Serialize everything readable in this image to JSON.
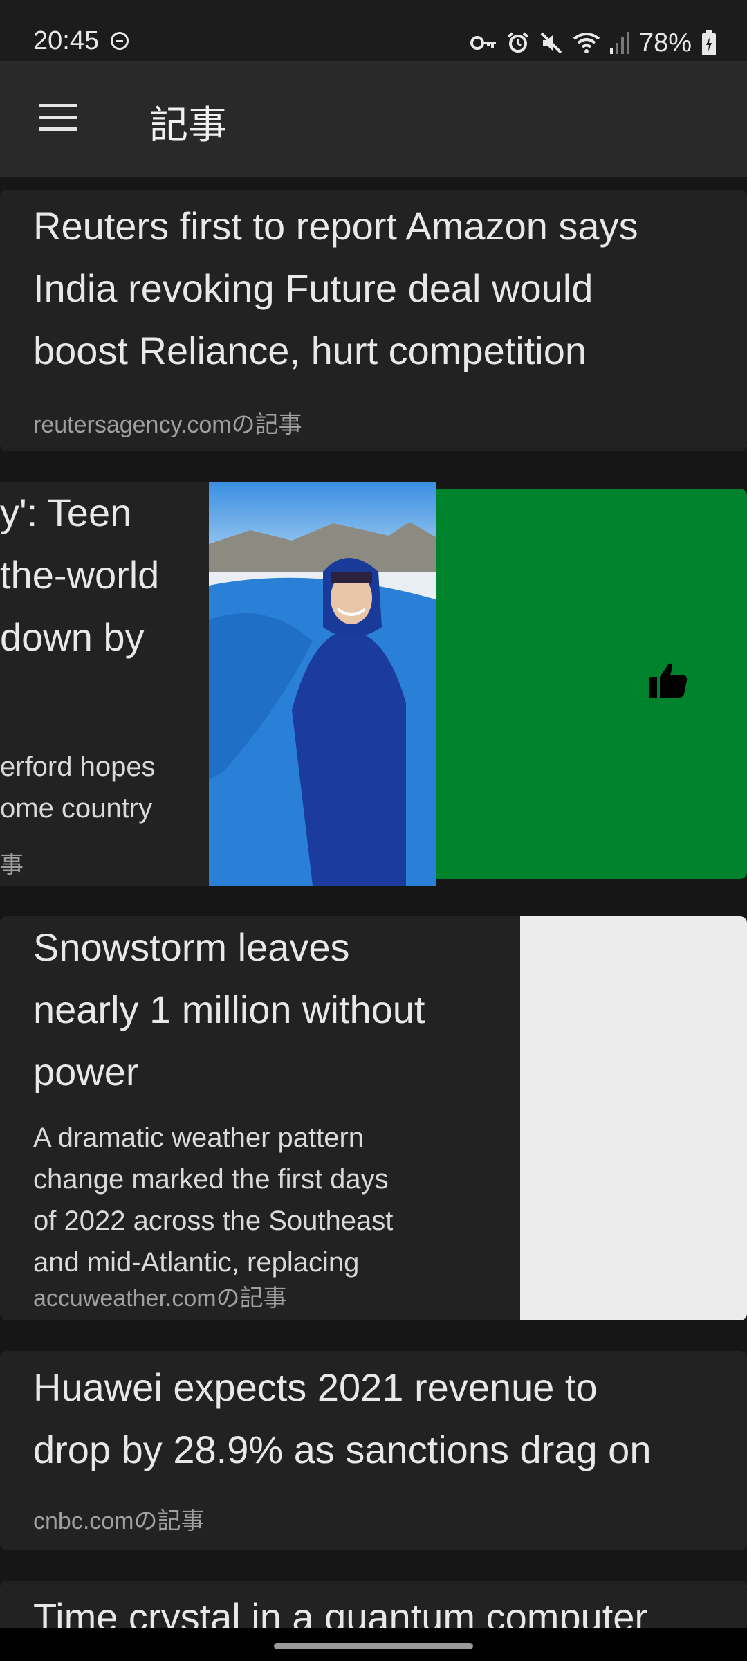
{
  "status_bar": {
    "time": "20:45",
    "battery": "78%",
    "icons": [
      "do-not-disturb-icon",
      "vpn-key-icon",
      "alarm-icon",
      "mute-icon",
      "wifi-icon",
      "signal-icon",
      "battery-icon"
    ]
  },
  "app_bar": {
    "title": "記事",
    "menu_icon": "hamburger-menu-icon"
  },
  "articles": [
    {
      "title": "Reuters first to report Amazon says\nIndia revoking Future deal would\nboost Reliance, hurt competition",
      "source": "reutersagency.comの記事"
    },
    {
      "title": "y': Teen\nthe-world\n down by",
      "snippet": "erford hopes\nome country",
      "source": "事",
      "swipe_action_icon": "thumbs-up-icon",
      "swipe_color": "#00832d"
    },
    {
      "title": "Snowstorm leaves\nnearly 1 million without\npower",
      "snippet": "A dramatic weather pattern\nchange marked the first days\nof 2022 across the Southeast\nand mid-Atlantic, replacing",
      "source": "accuweather.comの記事"
    },
    {
      "title": "Huawei expects 2021 revenue to\ndrop by 28.9% as sanctions drag on",
      "source": "cnbc.comの記事"
    },
    {
      "title": "Time crystal in a quantum computer"
    }
  ]
}
